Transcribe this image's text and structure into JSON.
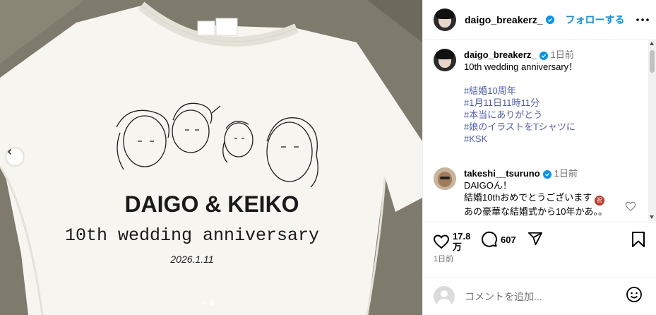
{
  "post": {
    "image": {
      "shirt_brand_line1": "DAIGO & KEIKO",
      "shirt_brand_line2": "10th wedding anniversary",
      "shirt_date": "2026.1.11",
      "carousel_total": 2,
      "carousel_active": 2
    },
    "header": {
      "username": "daigo_breakerz_",
      "follow_label": "フォローする",
      "verified": true
    },
    "caption": {
      "username": "daigo_breakerz_",
      "time": "1日前",
      "text": "10th wedding anniversary！",
      "hashtags": [
        "#結婚10周年",
        "#1月11日11時11分",
        "#本当にありがとう",
        "#娘のイラストをTシャツに",
        "#KSK"
      ]
    },
    "comments": [
      {
        "username": "takeshi__tsuruno",
        "time": "1日前",
        "lines": [
          "DAIGOん！",
          "結婚10thおめでとうございます",
          "あの豪華な結婚式から10年かあ。。"
        ],
        "emoji_label": "祝"
      }
    ],
    "actions": {
      "likes": "17.8万",
      "likes_line1": "17.8",
      "likes_line2": "万",
      "comments": "607"
    },
    "date": "1日前",
    "add_comment": {
      "placeholder": "コメントを追加..."
    }
  },
  "colors": {
    "accent": "#0095f6",
    "hashtag": "#4a5ec9",
    "muted": "#737373"
  }
}
